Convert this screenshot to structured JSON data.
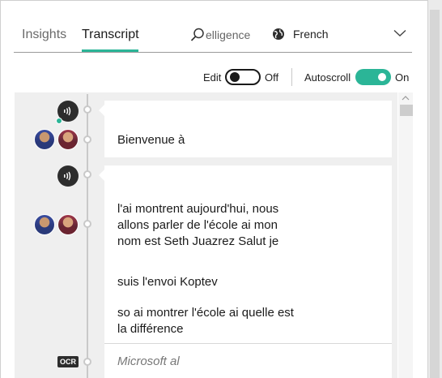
{
  "tabs": [
    {
      "label": "Insights",
      "active": false
    },
    {
      "label": "Transcript",
      "active": true
    }
  ],
  "search": {
    "visible_text": "elligence"
  },
  "language": {
    "selected": "French"
  },
  "toggles": {
    "edit": {
      "label": "Edit",
      "state": "Off",
      "on": false
    },
    "autoscroll": {
      "label": "Autoscroll",
      "state": "On",
      "on": true
    }
  },
  "transcript": {
    "entries": [
      {
        "lines": [
          "Bienvenue à"
        ]
      },
      {
        "lines": [
          "l'ai montrent aujourd'hui, nous",
          "allons parler de l'école ai mon",
          "nom est Seth Juazrez Salut je"
        ]
      },
      {
        "lines": [
          "suis l'envoi Koptev"
        ]
      },
      {
        "lines": [
          "so ai montrer l'école ai quelle est",
          "la différence"
        ]
      }
    ],
    "ocr": {
      "badge": "OCR",
      "text": "Microsoft al"
    }
  },
  "colors": {
    "accent": "#2bb597",
    "icon_dark": "#2d2d2d",
    "timeline": "#c9c9c9",
    "area_bg": "#efefef"
  },
  "icons": [
    "search-icon",
    "globe-icon",
    "chevron-down-icon",
    "audio-icon",
    "speaker-avatar",
    "ocr-badge",
    "scroll-up-icon"
  ]
}
